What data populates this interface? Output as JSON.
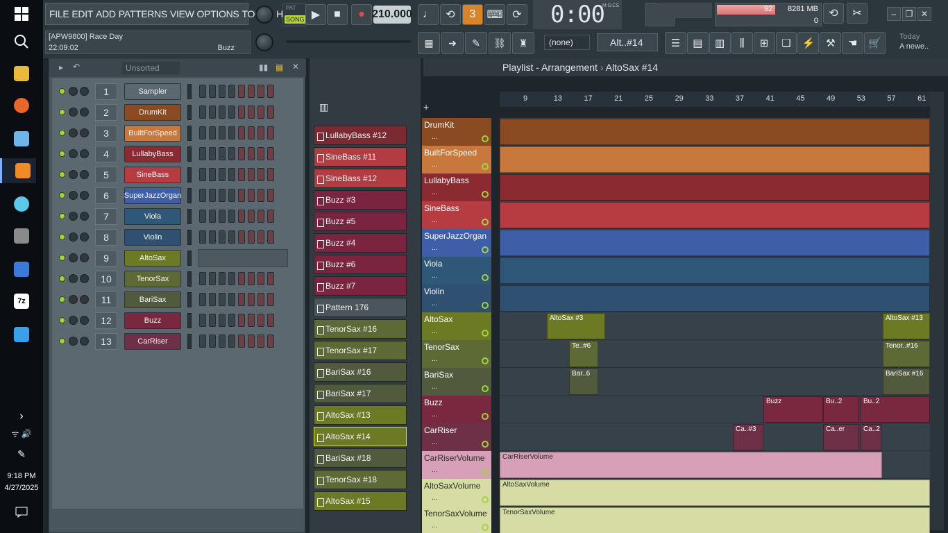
{
  "menu": [
    "FILE",
    "EDIT",
    "ADD",
    "PATTERNS",
    "VIEW",
    "OPTIONS",
    "TOOLS",
    "HELP"
  ],
  "hint": {
    "line1": "[APW9800] Race Day",
    "line2": "22:09:02",
    "right": "Buzz"
  },
  "transport": {
    "pat": "PAT",
    "song": "SONG",
    "tempo": "210.000",
    "time": "0:00",
    "time_sub": "00",
    "time_unit": "M:S:CS"
  },
  "monitor": {
    "cpu": "92",
    "mem": "8281 MB",
    "poly": "0",
    "poly2": "0"
  },
  "toolbar": {
    "none": "(none)",
    "pattern": "Alt..#14"
  },
  "news": {
    "line1": "Today",
    "line2": "A newe.."
  },
  "taskbar": {
    "time": "9:18 PM",
    "date": "4/27/2025"
  },
  "rack": {
    "sort": "Unsorted",
    "channels": [
      {
        "num": "1",
        "name": "Sampler",
        "color": "#5c686f"
      },
      {
        "num": "2",
        "name": "DrumKit",
        "color": "#8a4a22"
      },
      {
        "num": "3",
        "name": "BuiltForSpeed",
        "color": "#c8783c"
      },
      {
        "num": "4",
        "name": "LullabyBass",
        "color": "#8c2a32"
      },
      {
        "num": "5",
        "name": "SineBass",
        "color": "#b63c42"
      },
      {
        "num": "6",
        "name": "SuperJazzOrgan",
        "color": "#3f5ea8"
      },
      {
        "num": "7",
        "name": "Viola",
        "color": "#2f5878"
      },
      {
        "num": "8",
        "name": "Violin",
        "color": "#2f5070"
      },
      {
        "num": "9",
        "name": "AltoSax",
        "color": "#6d7a24"
      },
      {
        "num": "10",
        "name": "TenorSax",
        "color": "#5e6a36"
      },
      {
        "num": "11",
        "name": "BariSax",
        "color": "#525a3e"
      },
      {
        "num": "12",
        "name": "Buzz",
        "color": "#7a2840"
      },
      {
        "num": "13",
        "name": "CarRiser",
        "color": "#6e3046"
      }
    ]
  },
  "picker": [
    {
      "label": "LullabyBass #12",
      "color": "#7a2a30"
    },
    {
      "label": "SineBass #11",
      "color": "#b33c42"
    },
    {
      "label": "SineBass #12",
      "color": "#b33c42"
    },
    {
      "label": "Buzz #3",
      "color": "#7a2440"
    },
    {
      "label": "Buzz #5",
      "color": "#7a2440"
    },
    {
      "label": "Buzz #4",
      "color": "#7a2440"
    },
    {
      "label": "Buzz #6",
      "color": "#7a2440"
    },
    {
      "label": "Buzz #7",
      "color": "#7a2440"
    },
    {
      "label": "Pattern 176",
      "color": "#4b565c"
    },
    {
      "label": "TenorSax #16",
      "color": "#5e6a36"
    },
    {
      "label": "TenorSax #17",
      "color": "#5e6a36"
    },
    {
      "label": "BariSax #16",
      "color": "#525a3e"
    },
    {
      "label": "BariSax #17",
      "color": "#525a3e"
    },
    {
      "label": "AltoSax #13",
      "color": "#6d7a24"
    },
    {
      "label": "AltoSax #14",
      "color": "#6d7a24"
    },
    {
      "label": "BariSax #18",
      "color": "#525a3e"
    },
    {
      "label": "TenorSax #18",
      "color": "#5e6a36"
    },
    {
      "label": "AltoSax #15",
      "color": "#6d7a24"
    }
  ],
  "playlist": {
    "title": "Playlist - Arrangement",
    "pattern": "AltoSax #14",
    "ruler": [
      "9",
      "13",
      "17",
      "21",
      "25",
      "29",
      "33",
      "37",
      "41",
      "45",
      "49",
      "53",
      "57",
      "61"
    ],
    "tracks": [
      {
        "name": "DrumKit",
        "color": "#8a4a22",
        "clips": []
      },
      {
        "name": "BuiltForSpeed",
        "color": "#c8783c",
        "clips": []
      },
      {
        "name": "LullabyBass",
        "color": "#8c2a32",
        "clips": []
      },
      {
        "name": "SineBass",
        "color": "#b63c42",
        "clips": []
      },
      {
        "name": "SuperJazzOrgan",
        "color": "#3f5ea8",
        "clips": []
      },
      {
        "name": "Viola",
        "color": "#2f5878",
        "clips": []
      },
      {
        "name": "Violin",
        "color": "#2f5070",
        "clips": []
      },
      {
        "name": "AltoSax",
        "color": "#6d7a24",
        "clips": [
          "AltoSax #3",
          "AltoSax #13"
        ]
      },
      {
        "name": "TenorSax",
        "color": "#5e6a36",
        "clips": [
          "Te..#6",
          "Tenor..#16"
        ]
      },
      {
        "name": "BariSax",
        "color": "#525a3e",
        "clips": [
          "Bar..6",
          "BariSax #16"
        ]
      },
      {
        "name": "Buzz",
        "color": "#7a2840",
        "clips": [
          "Buzz",
          "Bu..2",
          "Bu..2"
        ]
      },
      {
        "name": "CarRiser",
        "color": "#6e3046",
        "clips": [
          "Ca..#3",
          "Ca..er",
          "Ca..2"
        ]
      },
      {
        "name": "CarRiserVolume",
        "color": "#d7a0b8",
        "clips": [
          "CarRiserVolume"
        ]
      },
      {
        "name": "AltoSaxVolume",
        "color": "#d6dca4",
        "clips": [
          "AltoSaxVolume"
        ]
      },
      {
        "name": "TenorSaxVolume",
        "color": "#d6dca4",
        "clips": [
          "TenorSaxVolume"
        ]
      }
    ]
  }
}
